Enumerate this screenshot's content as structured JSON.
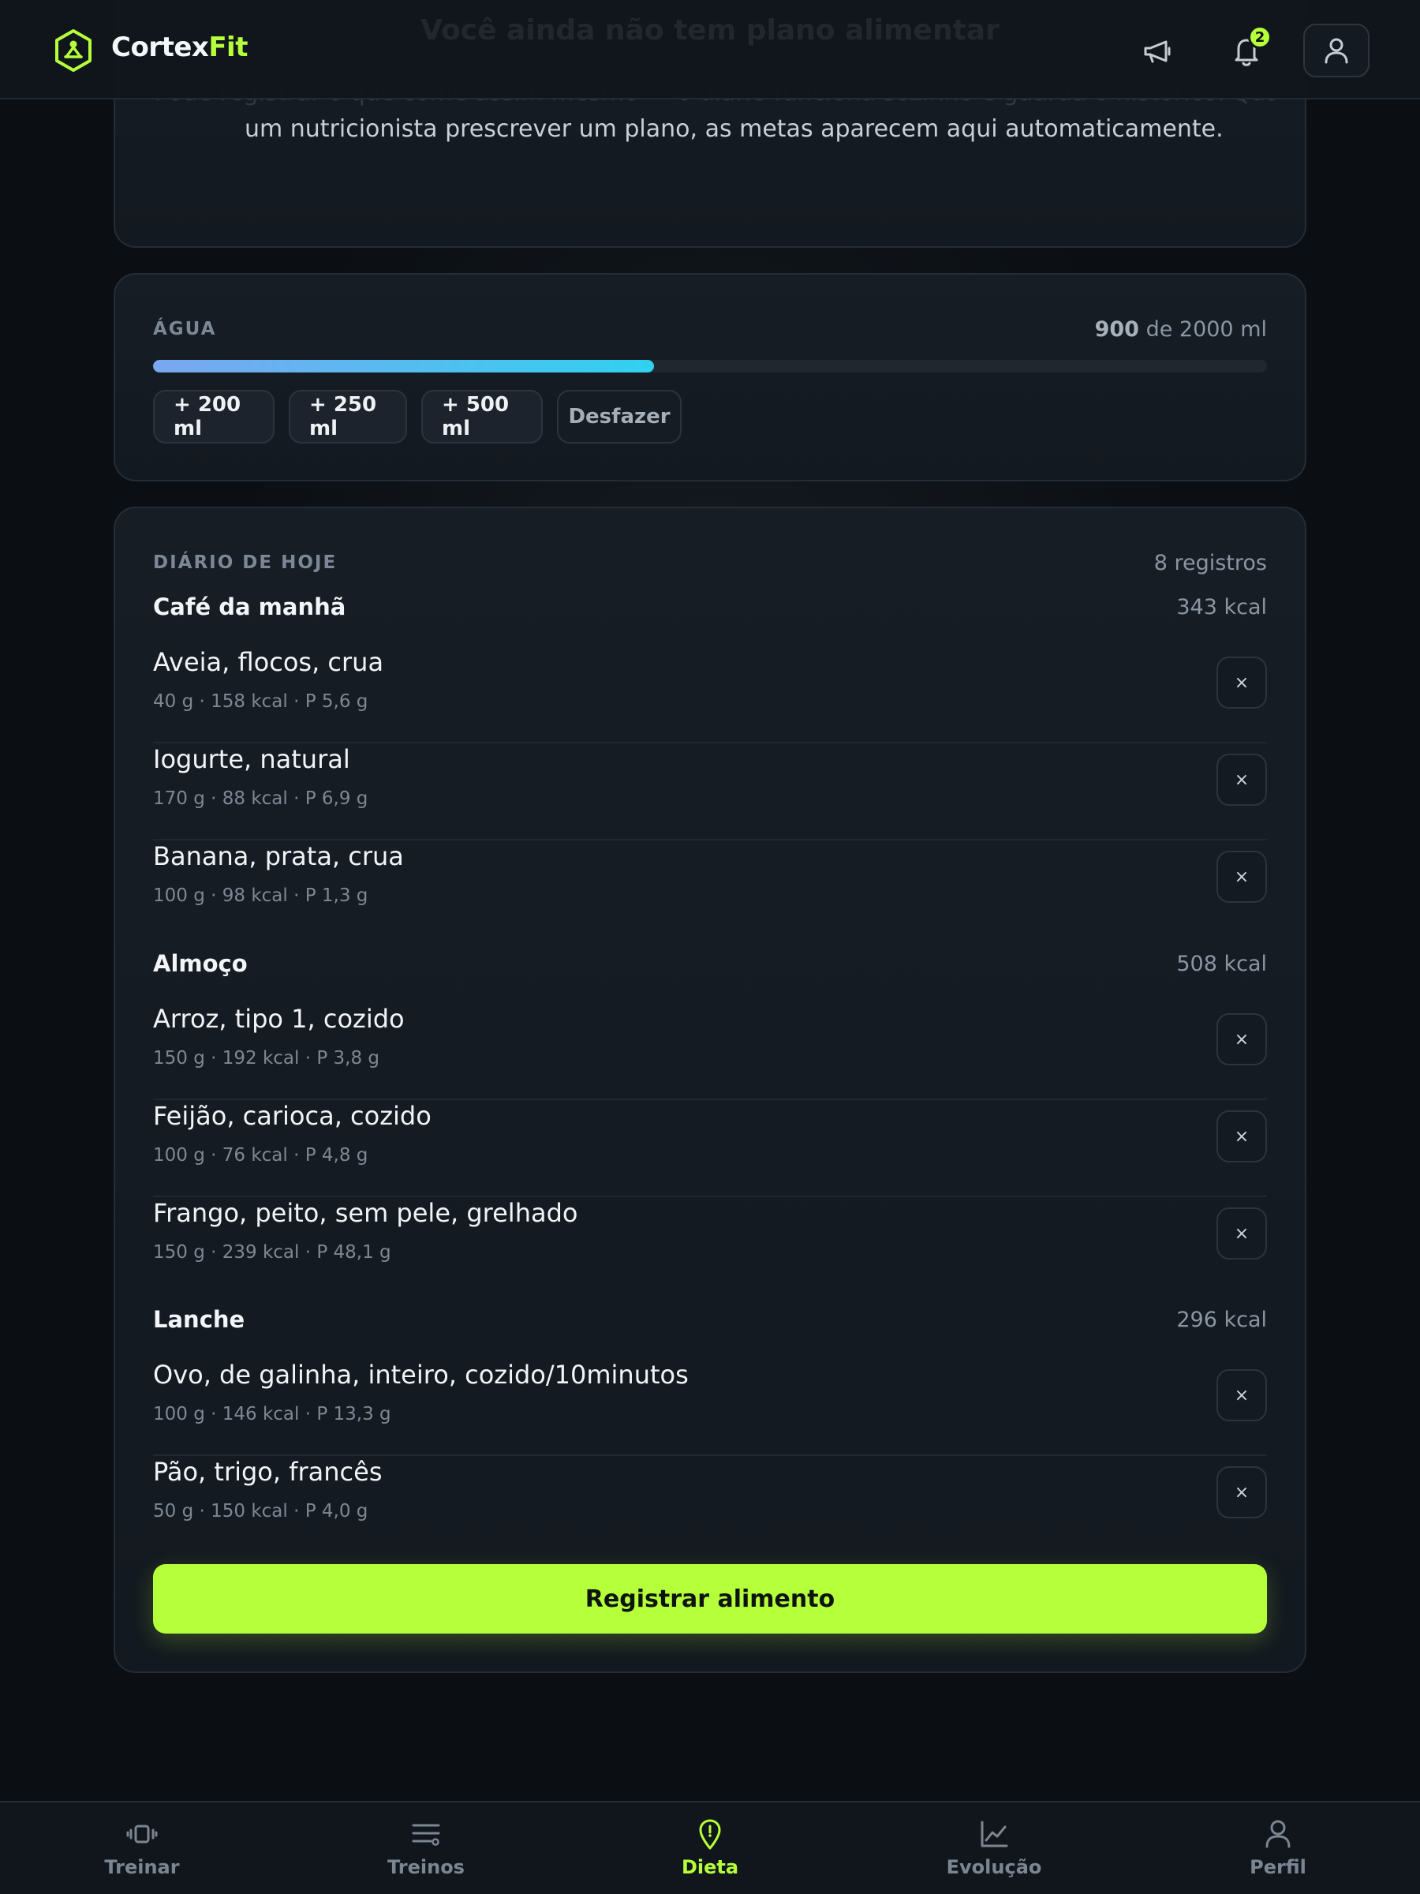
{
  "header": {
    "brand_part1": "Cortex",
    "brand_part2": "Fit",
    "ghost_heading": "Você ainda não tem plano alimentar",
    "notifications_count": "2",
    "icons": {
      "logo": "hexagon-logo-icon",
      "announcements": "megaphone-icon",
      "notifications": "bell-icon",
      "account": "user-icon"
    }
  },
  "notice": {
    "ghost_line": "Pode registrar o que come assim mesmo — o diário funciona sozinho e guarda o histórico. Quando",
    "line2": "um nutricionista prescrever um plano, as metas aparecem aqui automaticamente."
  },
  "water": {
    "label": "ÁGUA",
    "amount_value": "900",
    "amount_rest": "de 2000 ml",
    "progress_fraction": 0.45,
    "buttons": [
      "+ 200 ml",
      "+ 250 ml",
      "+ 500 ml"
    ],
    "undo": "Desfazer"
  },
  "diary": {
    "label": "DIÁRIO DE HOJE",
    "count": "8 registros",
    "meals": [
      {
        "name": "Café da manhã",
        "kcal": "343 kcal",
        "entries": [
          {
            "name": "Aveia, flocos, crua",
            "meta": "40 g · 158 kcal · P 5,6 g"
          },
          {
            "name": "Iogurte, natural",
            "meta": "170 g · 88 kcal · P 6,9 g"
          },
          {
            "name": "Banana, prata, crua",
            "meta": "100 g · 98 kcal · P 1,3 g"
          }
        ]
      },
      {
        "name": "Almoço",
        "kcal": "508 kcal",
        "entries": [
          {
            "name": "Arroz, tipo 1, cozido",
            "meta": "150 g · 192 kcal · P 3,8 g"
          },
          {
            "name": "Feijão, carioca, cozido",
            "meta": "100 g · 76 kcal · P 4,8 g"
          },
          {
            "name": "Frango, peito, sem pele, grelhado",
            "meta": "150 g · 239 kcal · P 48,1 g"
          }
        ]
      },
      {
        "name": "Lanche",
        "kcal": "296 kcal",
        "entries": [
          {
            "name": "Ovo, de galinha, inteiro, cozido/10minutos",
            "meta": "100 g · 146 kcal · P 13,3 g"
          },
          {
            "name": "Pão, trigo, francês",
            "meta": "50 g · 150 kcal · P 4,0 g"
          }
        ]
      }
    ],
    "remove_symbol": "×",
    "register_label": "Registrar alimento"
  },
  "nav": {
    "items": [
      {
        "label": "Treinar",
        "icon": "dumbbell-icon"
      },
      {
        "label": "Treinos",
        "icon": "list-icon"
      },
      {
        "label": "Dieta",
        "icon": "map-pin-icon",
        "active": true
      },
      {
        "label": "Evolução",
        "icon": "chart-line-icon"
      },
      {
        "label": "Perfil",
        "icon": "user-icon"
      }
    ]
  },
  "colors": {
    "accent": "#b6ff3b",
    "background": "#0b0f13",
    "card": "#171d25",
    "water_gradient_start": "#7aa7f0",
    "water_gradient_end": "#31d1f0"
  }
}
